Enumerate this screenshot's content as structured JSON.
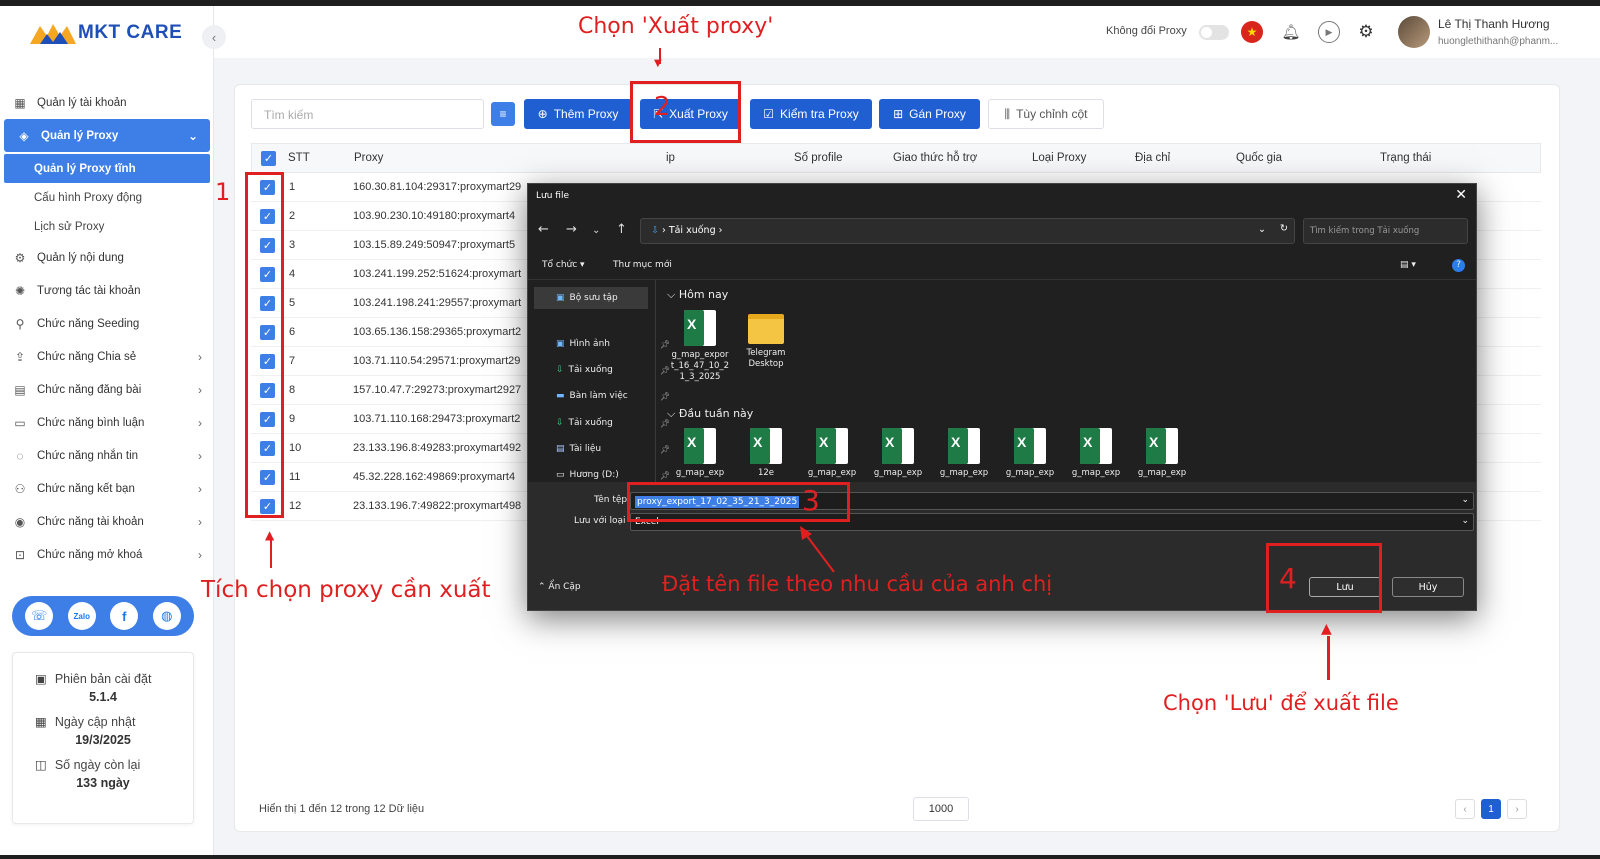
{
  "window": {
    "title": "Quản lý Proxy tĩnh"
  },
  "brand": {
    "name": "MKT CARE"
  },
  "header": {
    "proxy_label": "Không đổi Proxy",
    "user_name": "Lê Thị Thanh Hương",
    "user_email": "huonglethithanh@phanm..."
  },
  "sidebar": {
    "items": [
      {
        "label": "Quản lý tài khoản",
        "icon": "grid-icon"
      },
      {
        "label": "Quản lý Proxy",
        "icon": "layers-icon"
      },
      {
        "label": "Quản lý nội dung",
        "icon": "content-icon"
      },
      {
        "label": "Tương tác tài khoản",
        "icon": "sparkle-icon"
      },
      {
        "label": "Chức năng Seeding",
        "icon": "seed-icon"
      },
      {
        "label": "Chức năng Chia sẻ",
        "icon": "share-icon"
      },
      {
        "label": "Chức năng đăng bài",
        "icon": "post-icon"
      },
      {
        "label": "Chức năng bình luận",
        "icon": "comment-icon"
      },
      {
        "label": "Chức năng nhắn tin",
        "icon": "chat-icon"
      },
      {
        "label": "Chức năng kết bạn",
        "icon": "add-friend-icon"
      },
      {
        "label": "Chức năng tài khoản",
        "icon": "account-icon"
      },
      {
        "label": "Chức năng mở khoá",
        "icon": "unlock-icon"
      }
    ],
    "subitems": [
      "Quản lý Proxy tĩnh",
      "Cấu hình Proxy động",
      "Lịch sử Proxy"
    ],
    "info": {
      "version_label": "Phiên bản cài đặt",
      "version": "5.1.4",
      "updated_label": "Ngày cập nhật",
      "updated": "19/3/2025",
      "remaining_label": "Số ngày còn lại",
      "remaining": "133 ngày"
    }
  },
  "toolbar": {
    "search_placeholder": "Tìm kiếm",
    "add": "Thêm Proxy",
    "export": "Xuất Proxy",
    "check": "Kiểm tra Proxy",
    "assign": "Gán Proxy",
    "columns": "Tùy chỉnh cột"
  },
  "table": {
    "headers": [
      "STT",
      "Proxy",
      "ip",
      "Số profile",
      "Giao thức hỗ trợ",
      "Loại Proxy",
      "Địa chỉ",
      "Quốc gia",
      "Trạng thái"
    ],
    "rows": [
      {
        "stt": "1",
        "proxy": "160.30.81.104:29317:proxymart29"
      },
      {
        "stt": "2",
        "proxy": "103.90.230.10:49180:proxymart4"
      },
      {
        "stt": "3",
        "proxy": "103.15.89.249:50947:proxymart5"
      },
      {
        "stt": "4",
        "proxy": "103.241.199.252:51624:proxymart"
      },
      {
        "stt": "5",
        "proxy": "103.241.198.241:29557:proxymart"
      },
      {
        "stt": "6",
        "proxy": "103.65.136.158:29365:proxymart2"
      },
      {
        "stt": "7",
        "proxy": "103.71.110.54:29571:proxymart29"
      },
      {
        "stt": "8",
        "proxy": "157.10.47.7:29273:proxymart2927"
      },
      {
        "stt": "9",
        "proxy": "103.71.110.168:29473:proxymart2"
      },
      {
        "stt": "10",
        "proxy": "23.133.196.8:49283:proxymart492"
      },
      {
        "stt": "11",
        "proxy": "45.32.228.162:49869:proxymart4"
      },
      {
        "stt": "12",
        "proxy": "23.133.196.7:49822:proxymart498"
      }
    ],
    "footer": "Hiển thị 1 đến 12 trong 12 Dữ liệu",
    "page_size": "1000",
    "page": "1"
  },
  "dialog": {
    "title": "Lưu file",
    "path": "Tải xuống",
    "search_placeholder": "Tìm kiếm trong Tải xuống",
    "organize": "Tổ chức",
    "new_folder": "Thư mục mới",
    "nav": [
      "Bộ sưu tập",
      "Hình ảnh",
      "Tải xuống",
      "Bàn làm việc",
      "Tải xuống",
      "Tài liệu",
      "Hương (D:)"
    ],
    "group_today": "Hôm nay",
    "group_week": "Đầu tuần này",
    "today_files": [
      {
        "name": "g_map_export_16_47_10_21_3_2025",
        "type": "excel"
      },
      {
        "name": "Telegram Desktop",
        "type": "folder"
      }
    ],
    "week_files": [
      "g_map_exp",
      "12e",
      "g_map_exp",
      "g_map_exp",
      "g_map_exp",
      "g_map_exp",
      "g_map_exp",
      "g_map_exp"
    ],
    "filename_label": "Tên tệp",
    "filename": "proxy_export_17_02_35_21_3_2025",
    "filetype_label": "Lưu với loại",
    "filetype": "Excel",
    "hide_folders": "Ẩn Cặp",
    "save": "Lưu",
    "cancel": "Hủy"
  },
  "annotations": {
    "step1": "1",
    "step2": "2",
    "step3": "3",
    "step4": "4",
    "choose_export": "Chọn 'Xuất proxy'",
    "tick_proxy": "Tích chọn proxy cần xuất",
    "name_file": "Đặt tên file theo nhu cầu của anh chị",
    "choose_save": "Chọn 'Lưu' để xuất file",
    "color": "#e02020"
  }
}
